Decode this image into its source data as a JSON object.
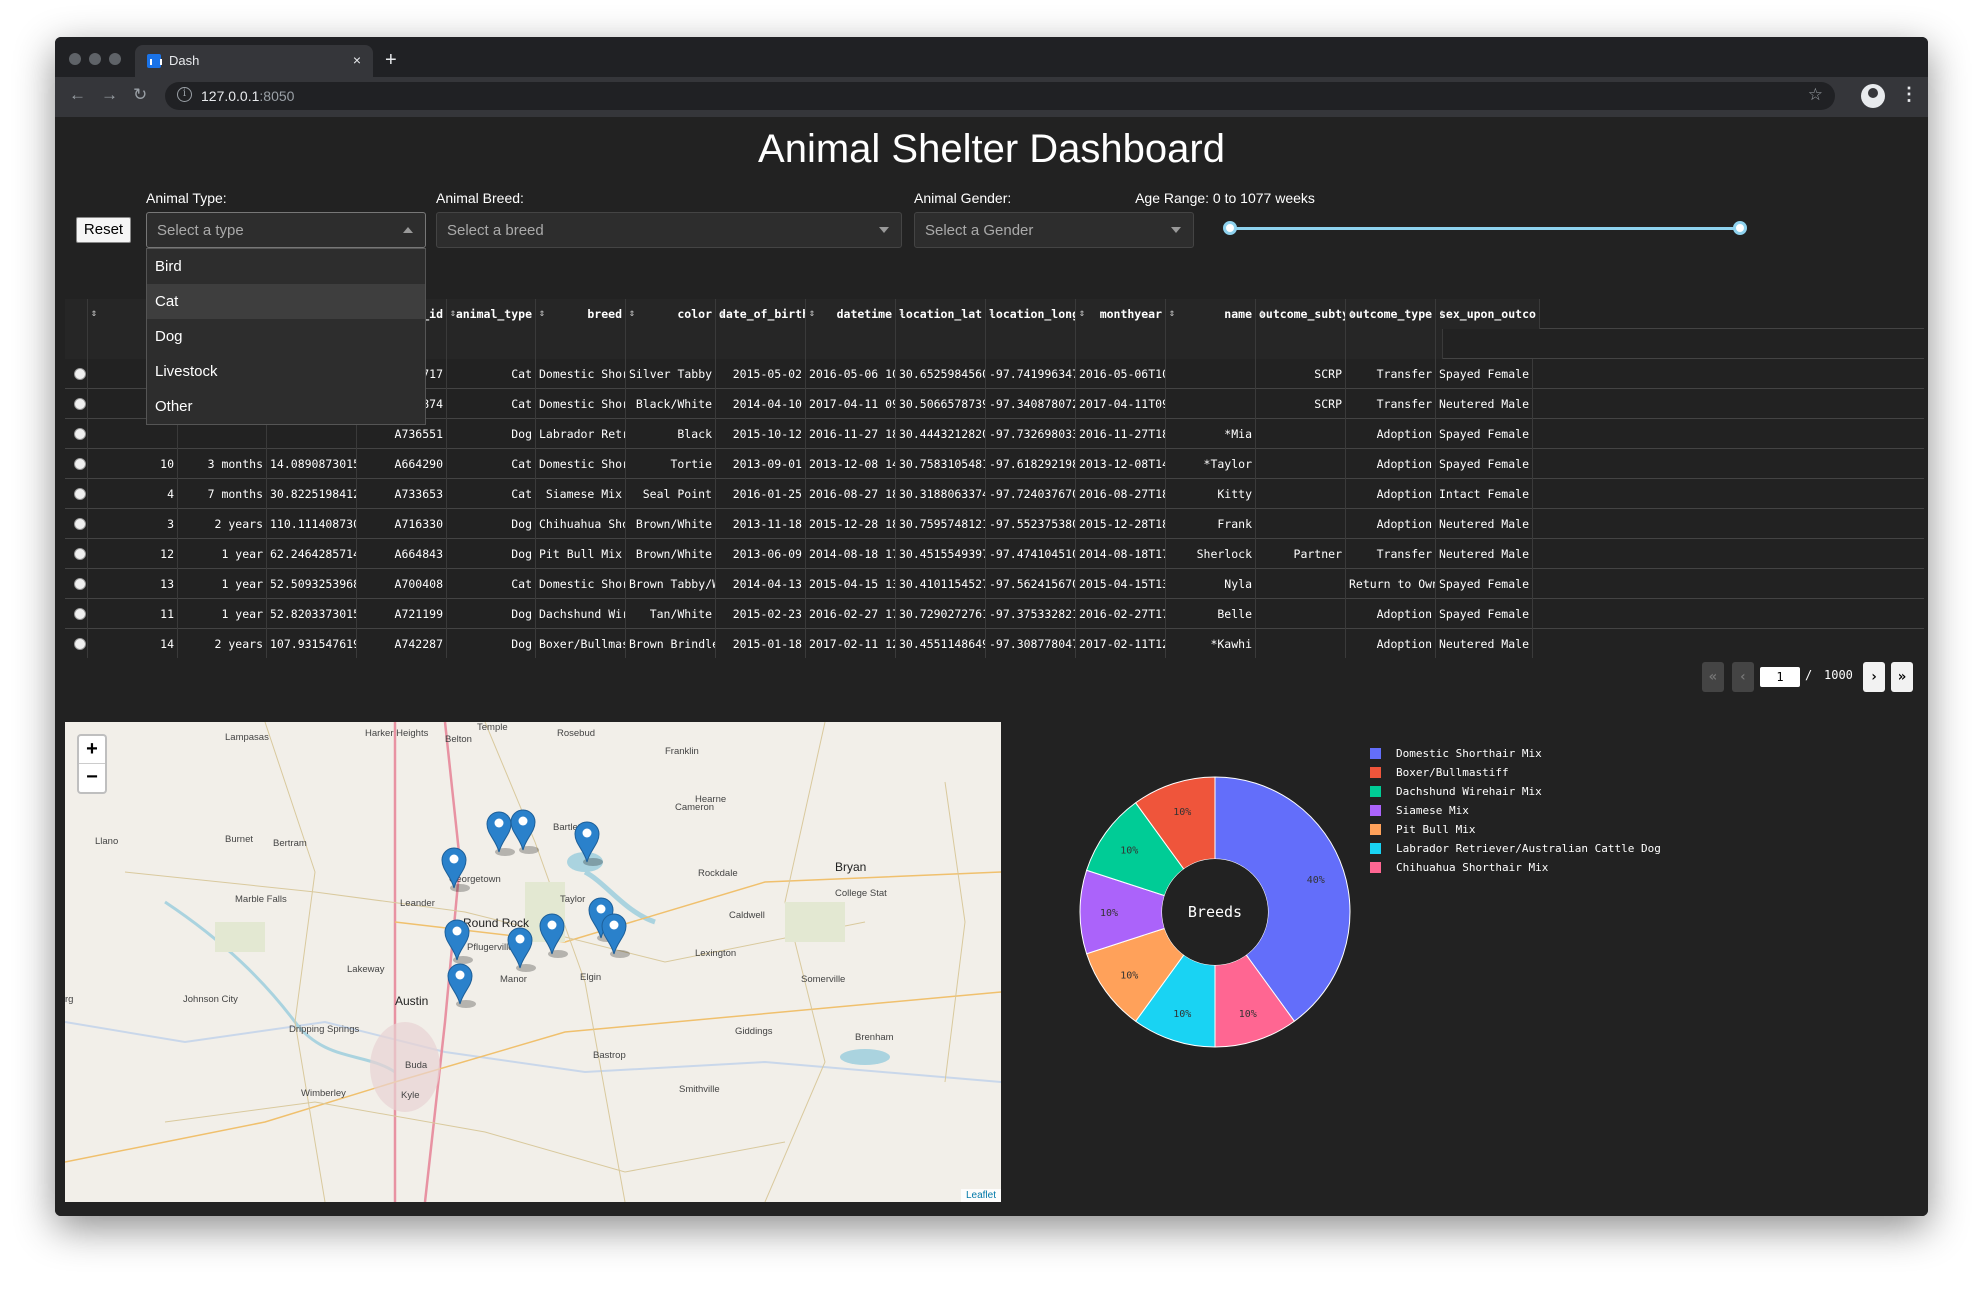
{
  "browser": {
    "tab_title": "Dash",
    "tab_close": "×",
    "new_tab": "+",
    "url_host": "127.0.0.1",
    "url_port": ":8050",
    "back": "←",
    "forward": "→",
    "reload": "↻",
    "info": "i",
    "bookmark": "☆",
    "menu": "⋮"
  },
  "page": {
    "title": "Animal Shelter Dashboard",
    "reset_label": "Reset"
  },
  "filters": {
    "type_label": "Animal Type:",
    "type_placeholder": "Select a type",
    "type_options": [
      "Bird",
      "Cat",
      "Dog",
      "Livestock",
      "Other"
    ],
    "type_highlighted": "Cat",
    "breed_label": "Animal Breed:",
    "breed_placeholder": "Select a breed",
    "gender_label": "Animal Gender:",
    "gender_placeholder": "Select a Gender",
    "age_label": "Age Range: 0 to 1077 weeks",
    "age_min": 0,
    "age_max": 1077,
    "age_selected": [
      0,
      1077
    ]
  },
  "table": {
    "columns": [
      "",
      "",
      "o",
      "animal_id",
      "animal_type",
      "breed",
      "color",
      "date_of_birth",
      "datetime",
      "location_lat",
      "location_long",
      "monthyear",
      "name",
      "outcome_subtyp",
      "outcome_type",
      "sex_upon_outco"
    ],
    "rows": [
      [
        "",
        "",
        "",
        "A725717",
        "Cat",
        "Domestic Shor…",
        "Silver Tabby",
        "2015-05-02",
        "2016-05-06 10…",
        "30.6525984560…",
        "-97.741996347…",
        "2016-05-06T10…",
        "",
        "SCRP",
        "Transfer",
        "Spayed Female"
      ],
      [
        "",
        "",
        "",
        "A746874",
        "Cat",
        "Domestic Shor…",
        "Black/White",
        "2014-04-10",
        "2017-04-11 09…",
        "30.5066578739…",
        "-97.340878072…",
        "2017-04-11T09…",
        "",
        "SCRP",
        "Transfer",
        "Neutered Male"
      ],
      [
        "",
        "",
        "",
        "A736551",
        "Dog",
        "Labrador Retr…",
        "Black",
        "2015-10-12",
        "2016-11-27 18…",
        "30.4443212820…",
        "-97.732698033…",
        "2016-11-27T18…",
        "*Mia",
        "",
        "Adoption",
        "Spayed Female"
      ],
      [
        "10",
        "3 months",
        "14.0890873015…",
        "A664290",
        "Cat",
        "Domestic Shor…",
        "Tortie",
        "2013-09-01",
        "2013-12-08 14…",
        "30.7583105481…",
        "-97.618292198…",
        "2013-12-08T14…",
        "*Taylor",
        "",
        "Adoption",
        "Spayed Female"
      ],
      [
        "4",
        "7 months",
        "30.8225198412…",
        "A733653",
        "Cat",
        "Siamese Mix",
        "Seal Point",
        "2016-01-25",
        "2016-08-27 18…",
        "30.3188063374…",
        "-97.724037670…",
        "2016-08-27T18…",
        "Kitty",
        "",
        "Adoption",
        "Intact Female"
      ],
      [
        "3",
        "2 years",
        "110.111408730…",
        "A716330",
        "Dog",
        "Chihuahua Sho…",
        "Brown/White",
        "2013-11-18",
        "2015-12-28 18…",
        "30.7595748121…",
        "-97.552375380…",
        "2015-12-28T18…",
        "Frank",
        "",
        "Adoption",
        "Neutered Male"
      ],
      [
        "12",
        "1 year",
        "62.2464285714…",
        "A664843",
        "Dog",
        "Pit Bull Mix",
        "Brown/White",
        "2013-06-09",
        "2014-08-18 17…",
        "30.4515549397…",
        "-97.474104510…",
        "2014-08-18T17…",
        "Sherlock",
        "Partner",
        "Transfer",
        "Neutered Male"
      ],
      [
        "13",
        "1 year",
        "52.5093253968…",
        "A700408",
        "Cat",
        "Domestic Shor…",
        "Brown Tabby/W…",
        "2014-04-13",
        "2015-04-15 13…",
        "30.4101154527…",
        "-97.562415670…",
        "2015-04-15T13…",
        "Nyla",
        "",
        "Return to Own…",
        "Spayed Female"
      ],
      [
        "11",
        "1 year",
        "52.8203373015…",
        "A721199",
        "Dog",
        "Dachshund Wir…",
        "Tan/White",
        "2015-02-23",
        "2016-02-27 17…",
        "30.7290272761…",
        "-97.375332821…",
        "2016-02-27T17…",
        "Belle",
        "",
        "Adoption",
        "Spayed Female"
      ],
      [
        "14",
        "2 years",
        "107.931547619…",
        "A742287",
        "Dog",
        "Boxer/Bullmas…",
        "Brown Brindle…",
        "2015-01-18",
        "2017-02-11 12…",
        "30.4551148649…",
        "-97.308778047…",
        "2017-02-11T12…",
        "*Kawhi",
        "",
        "Adoption",
        "Neutered Male"
      ]
    ]
  },
  "pagination": {
    "first": "«",
    "prev": "‹",
    "current": "1",
    "separator": "/",
    "total": "1000",
    "next": "›",
    "last": "»"
  },
  "map": {
    "zoom_in": "+",
    "zoom_out": "−",
    "attribution": "Leaflet",
    "places": [
      "Lampasas",
      "Harker Heights",
      "Belton",
      "Temple",
      "Rosebud",
      "Franklin",
      "Cameron",
      "Hearne",
      "Bryan",
      "College Stat",
      "Llano",
      "Burnet",
      "Bertram",
      "Bartlett",
      "Georgetown",
      "Rockdale",
      "Marble Falls",
      "Leander",
      "Round Rock",
      "Taylor",
      "Caldwell",
      "Pflugerville",
      "Lakeway",
      "Manor",
      "Elgin",
      "Lexington",
      "Somerville",
      "Austin",
      "Johnson City",
      "Dripping Springs",
      "Giddings",
      "Brenham",
      "Buda",
      "Bastrop",
      "Wimberley",
      "Kyle",
      "Smithville",
      "rg"
    ]
  },
  "chart_data": {
    "type": "pie",
    "hole_label": "Breeds",
    "labels": [
      "Domestic Shorthair Mix",
      "Boxer/Bullmastiff",
      "Dachshund Wirehair Mix",
      "Siamese Mix",
      "Pit Bull Mix",
      "Labrador Retriever/Australian Cattle Dog",
      "Chihuahua Shorthair Mix"
    ],
    "values": [
      40,
      10,
      10,
      10,
      10,
      10,
      10
    ],
    "slice_order": [
      "Domestic Shorthair Mix",
      "Chihuahua Shorthair Mix",
      "Labrador Retriever/Australian Cattle Dog",
      "Pit Bull Mix",
      "Siamese Mix",
      "Dachshund Wirehair Mix",
      "Boxer/Bullmastiff"
    ],
    "colors": {
      "Domestic Shorthair Mix": "#636efa",
      "Boxer/Bullmastiff": "#ef553b",
      "Dachshund Wirehair Mix": "#00cc96",
      "Siamese Mix": "#ab63fa",
      "Pit Bull Mix": "#ffa15a",
      "Labrador Retriever/Australian Cattle Dog": "#19d3f3",
      "Chihuahua Shorthair Mix": "#ff6692"
    },
    "legend_position": "right"
  },
  "colors": {
    "page_bg": "#222222",
    "slider_accent": "#8fd3ef",
    "marker": "#2a81cb"
  }
}
